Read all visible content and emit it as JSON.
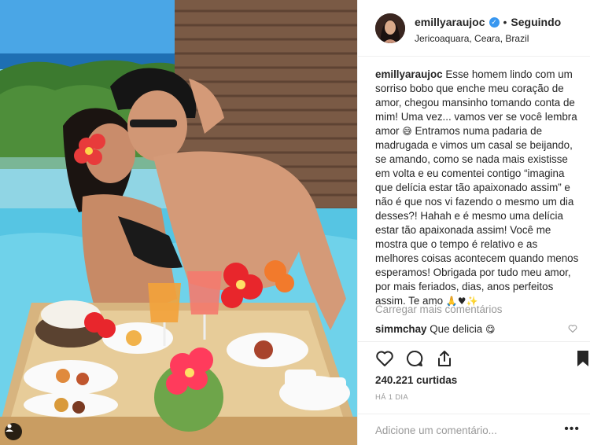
{
  "post": {
    "username": "emillyaraujoc",
    "follow_status": "Seguindo",
    "separator": "•",
    "location": "Jericoaquara, Ceara, Brazil",
    "verified_icon": "verified-badge-icon",
    "caption": {
      "username": "emillyaraujoc",
      "text_before_emoji_1": "Esse homem lindo com um sorriso bobo que enche meu coração de amor, chegou mansinho tomando conta de mim! Uma vez... vamos ver se você lembra amor",
      "emoji_1": "😅",
      "text_after_emoji_1": "Entramos numa padaria de madrugada e vimos um casal se beijando, se amando, como se nada mais existisse em volta e eu comentei contigo “imagina que delícia estar tão apaixonado assim” e não é que nos vi fazendo o mesmo um dia desses?! Hahah e é mesmo uma delícia estar tão apaixonada assim! Você me mostra que o tempo é relativo e as melhores coisas acontecem quando menos esperamos! Obrigada por tudo meu amor, por mais feriados, dias, anos perfeitos assim. Te amo",
      "emoji_2": "🙏♥✨"
    },
    "load_more_comments": "Carregar mais comentários",
    "comments": [
      {
        "username": "simmchay",
        "text": "Que delicia",
        "emoji": "😋"
      }
    ],
    "likes": "240.221 curtidas",
    "time": "HÁ 1 DIA",
    "add_comment_placeholder": "Adicione um comentário...",
    "more_options": "•••"
  },
  "icons": {
    "like": "heart-icon",
    "comment": "comment-bubble-icon",
    "share": "share-icon",
    "save": "bookmark-icon",
    "user_tag": "person-tag-icon"
  },
  "colors": {
    "verified": "#3897f0",
    "muted": "#999999",
    "text": "#262626",
    "divider": "#efefef"
  }
}
